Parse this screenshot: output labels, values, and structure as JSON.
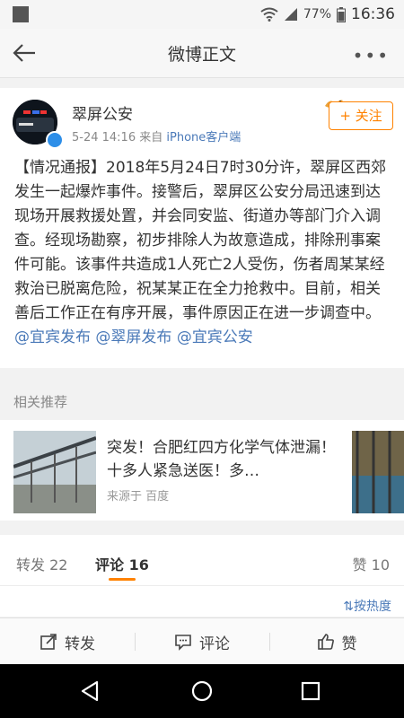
{
  "status_bar": {
    "battery": "77%",
    "time": "16:36"
  },
  "nav": {
    "title": "微博正文"
  },
  "post": {
    "author": "翠屏公安",
    "time": "5-24 14:16",
    "source_prefix": "来自",
    "source": "iPhone客户端",
    "follow_label": "关注",
    "text": "【情况通报】2018年5月24日7时30分许，翠屏区西郊发生一起爆炸事件。接警后，翠屏区公安分局迅速到达现场开展救援处置，并会同安监、街道办等部门介入调查。经现场勘察，初步排除人为故意造成，排除刑事案件可能。该事件共造成1人死亡2人受伤，伤者周某某经救治已脱离危险，祝某某正在全力抢救中。目前，相关善后工作正在有序开展，事件原因正在进一步调查中。",
    "mentions": [
      "@宜宾发布",
      "@翠屏发布",
      "@宜宾公安"
    ]
  },
  "related": {
    "title": "相关推荐",
    "headline": "突发！合肥红四方化学气体泄漏！十多人紧急送医！多…",
    "source": "来源于 百度"
  },
  "tabs": {
    "repost": "转发 22",
    "comment": "评论 16",
    "like": "赞 10"
  },
  "sort_label": "按热度",
  "actions": {
    "repost": "转发",
    "comment": "评论",
    "like": "赞"
  }
}
